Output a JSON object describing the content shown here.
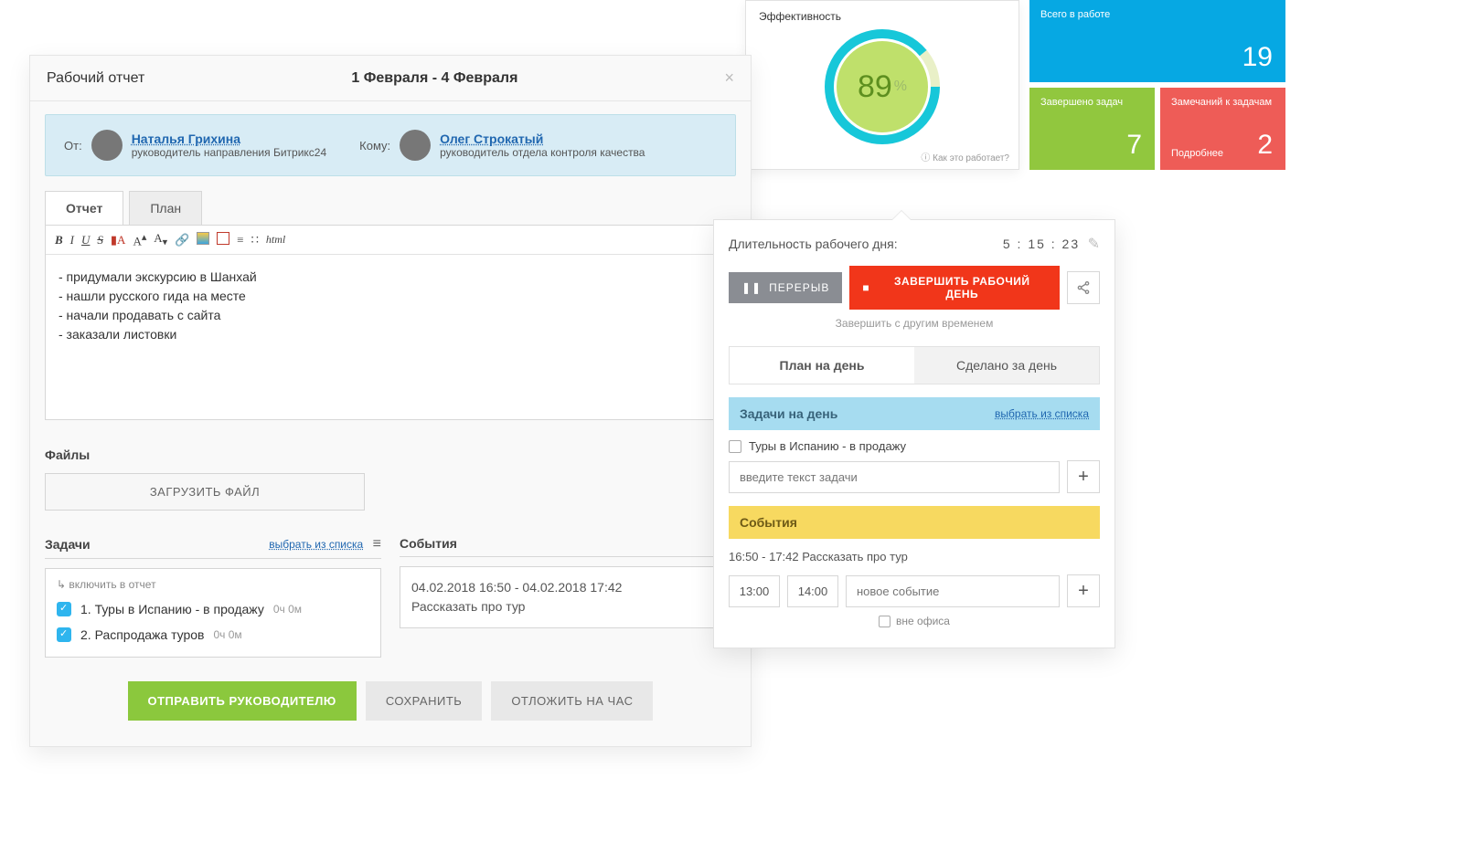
{
  "report": {
    "title": "Рабочий отчет",
    "period": "1 Февраля - 4 Февраля",
    "from_label": "От:",
    "from_name": "Наталья Грихина",
    "from_pos": "руководитель направления Битрикс24",
    "to_label": "Кому:",
    "to_name": "Олег Строкатый",
    "to_pos": "руководитель отдела контроля качества",
    "tabs": {
      "report": "Отчет",
      "plan": "План"
    },
    "toolbar": {
      "html": "html"
    },
    "body": "- придумали экскурсию в Шанхай\n- нашли русского гида на месте\n- начали продавать с сайта\n- заказали листовки",
    "files_h": "Файлы",
    "upload": "ЗАГРУЗИТЬ ФАЙЛ",
    "tasks_h": "Задачи",
    "tasks_link": "выбрать из списка",
    "tasks_include": "включить в отчет",
    "tasks": [
      {
        "label": "1. Туры в Испанию - в продажу",
        "time": "0ч 0м"
      },
      {
        "label": "2. Распродажа туров",
        "time": "0ч 0м"
      }
    ],
    "events_h": "События",
    "event_time": "04.02.2018 16:50 - 04.02.2018 17:42",
    "event_title": "Рассказать про тур",
    "actions": {
      "send": "ОТПРАВИТЬ РУКОВОДИТЕЛЮ",
      "save": "СОХРАНИТЬ",
      "delay": "ОТЛОЖИТЬ НА ЧАС"
    }
  },
  "effectiveness": {
    "title": "Эффективность",
    "value": "89",
    "percent": "%",
    "footer": "Как это работает?",
    "colors": {
      "ring": "#17c7d9",
      "fill": "#bfe06b",
      "gap": "#e9f0c7"
    }
  },
  "tiles": {
    "in_work": {
      "label": "Всего в работе",
      "value": "19"
    },
    "done": {
      "label": "Завершено задач",
      "value": "7"
    },
    "remarks": {
      "label": "Замечаний к задачам",
      "value": "2",
      "more": "Подробнее"
    }
  },
  "day": {
    "len_label": "Длительность рабочего дня:",
    "len_value": "5 : 15 : 23",
    "pause": "ПЕРЕРЫВ",
    "stop": "ЗАВЕРШИТЬ РАБОЧИЙ ДЕНЬ",
    "other_time": "Завершить с другим временем",
    "tabs": {
      "plan": "План на день",
      "done": "Сделано за день"
    },
    "tasks_bar": "Задачи на день",
    "tasks_sel": "выбрать из списка",
    "task1": "Туры в Испанию - в продажу",
    "task_ph": "введите текст задачи",
    "events_bar": "События",
    "event_line": "16:50 - 17:42   Рассказать про тур",
    "t_from": "13:00",
    "t_to": "14:00",
    "event_ph": "новое событие",
    "out_office": "вне офиса"
  }
}
